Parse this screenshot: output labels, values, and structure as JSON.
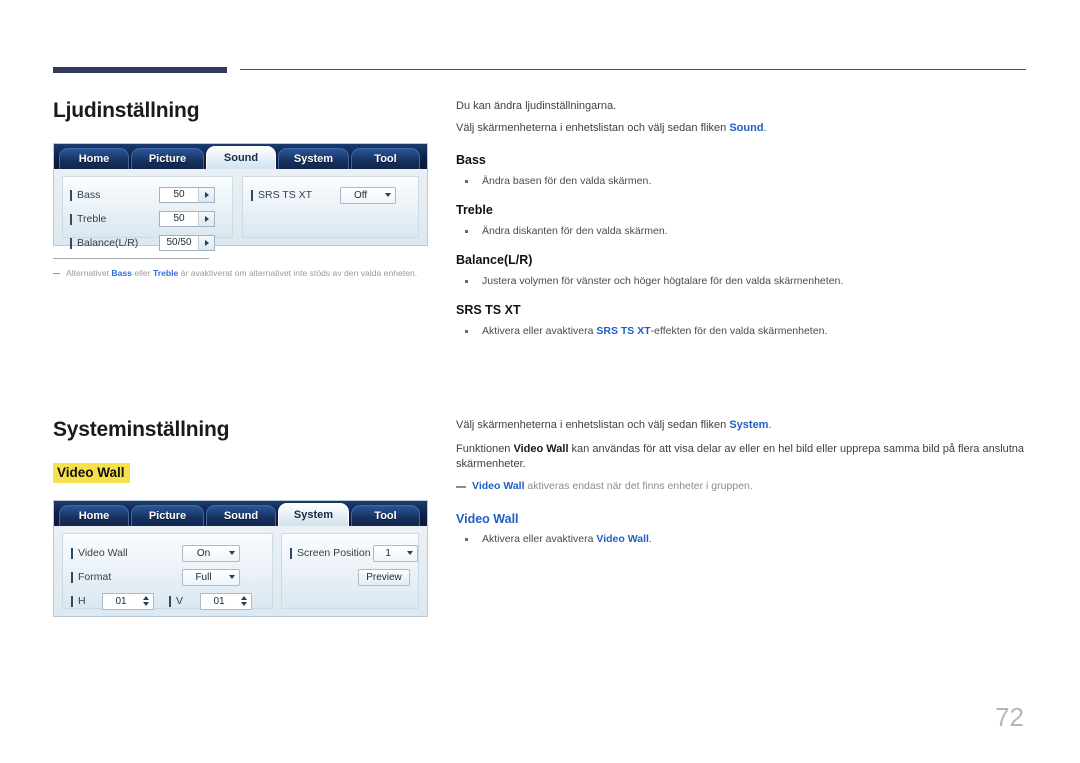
{
  "page": {
    "number": "72"
  },
  "sound_section": {
    "heading": "Ljudinställning",
    "intro1": "Du kan ändra ljudinställningarna.",
    "intro2_before": "Välj skärmenheterna i enhetslistan och välj sedan fliken ",
    "intro2_link": "Sound",
    "intro2_after": ".",
    "items": [
      {
        "title": "Bass",
        "desc": "Ändra basen för den valda skärmen."
      },
      {
        "title": "Treble",
        "desc": "Ändra diskanten för den valda skärmen."
      },
      {
        "title": "Balance(L/R)",
        "desc": "Justera volymen för vänster och höger högtalare för den valda skärmenheten."
      },
      {
        "title": "SRS TS XT",
        "desc_before": "Aktivera eller avaktivera ",
        "desc_link": "SRS TS XT",
        "desc_after": "-effekten för den valda skärmenheten."
      }
    ],
    "footnote": {
      "before": "Alternativet ",
      "link1": "Bass",
      "mid": " eller ",
      "link2": "Treble",
      "after": " är avaktiverat om alternativet inte stöds av den valda enheten."
    },
    "panel": {
      "tabs": [
        {
          "label": "Home",
          "active": false
        },
        {
          "label": "Picture",
          "active": false
        },
        {
          "label": "Sound",
          "active": true
        },
        {
          "label": "System",
          "active": false
        },
        {
          "label": "Tool",
          "active": false
        }
      ],
      "left_rows": [
        {
          "label": "Bass",
          "value": "50"
        },
        {
          "label": "Treble",
          "value": "50"
        },
        {
          "label": "Balance(L/R)",
          "value": "50/50"
        }
      ],
      "right_rows": [
        {
          "label": "SRS TS XT",
          "value": "Off"
        }
      ]
    }
  },
  "system_section": {
    "heading": "Systeminställning",
    "highlight": "Video Wall",
    "intro1_before": "Välj skärmenheterna i enhetslistan och välj sedan fliken ",
    "intro1_link": "System",
    "intro1_after": ".",
    "intro2_before": "Funktionen ",
    "intro2_link": "Video Wall",
    "intro2_after": " kan användas för att visa delar av eller en hel bild eller upprepa samma bild på flera anslutna skärmenheter.",
    "note_link": "Video Wall",
    "note_text": " aktiveras endast när det finns enheter i gruppen.",
    "item_heading": "Video Wall",
    "item_desc_before": "Aktivera eller avaktivera ",
    "item_desc_link": "Video Wall",
    "item_desc_after": ".",
    "panel": {
      "tabs": [
        {
          "label": "Home",
          "active": false
        },
        {
          "label": "Picture",
          "active": false
        },
        {
          "label": "Sound",
          "active": false
        },
        {
          "label": "System",
          "active": true
        },
        {
          "label": "Tool",
          "active": false
        }
      ],
      "video_wall_label": "Video Wall",
      "video_wall_value": "On",
      "format_label": "Format",
      "format_value": "Full",
      "h_label": "H",
      "h_value": "01",
      "v_label": "V",
      "v_value": "01",
      "screen_position_label": "Screen Position",
      "screen_position_value": "1",
      "preview_label": "Preview"
    }
  },
  "colors": {
    "accent_blue": "#1f5fc4",
    "highlight_yellow": "#f7e14a",
    "header_navy": "#343a5e"
  }
}
